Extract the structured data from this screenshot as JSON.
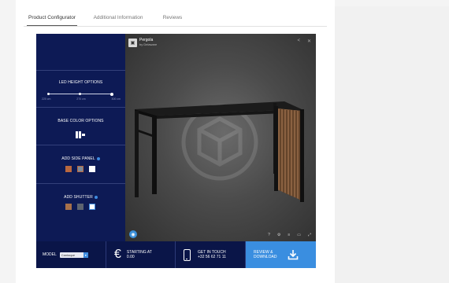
{
  "tabs": [
    {
      "label": "Product Configurator",
      "active": true
    },
    {
      "label": "Additional Information",
      "active": false
    },
    {
      "label": "Reviews",
      "active": false
    }
  ],
  "viewer": {
    "title": "Pergola",
    "subtitle": "by Delaware"
  },
  "options": {
    "led": {
      "title": "LED HEIGHT OPTIONS",
      "labels": [
        "220 cm",
        "270 cm",
        "300 cm"
      ],
      "selected_index": 2
    },
    "base_color": {
      "title": "BASE COLOR OPTIONS"
    },
    "side_panel": {
      "title": "ADD SIDE PANEL",
      "swatches": [
        "#b9683f",
        "#7c8a99",
        "#ffffff"
      ]
    },
    "shutter": {
      "title": "ADD SHUTTER",
      "swatches": [
        "#a7704a",
        "#5d6470",
        "#ffffff"
      ]
    }
  },
  "bottom": {
    "model_label": "MODEL",
    "model_value": "Cantaque",
    "currency_symbol": "€",
    "price_label": "STARTING AT",
    "price_value": "0.00",
    "contact_label": "GET IN TOUCH",
    "contact_phone": "+32 56 62 71 11",
    "review_line1": "REVIEW &",
    "review_line2": "DOWNLOAD"
  },
  "colors": {
    "panel_bg": "#0d1a55",
    "accent": "#3a8ee0"
  }
}
